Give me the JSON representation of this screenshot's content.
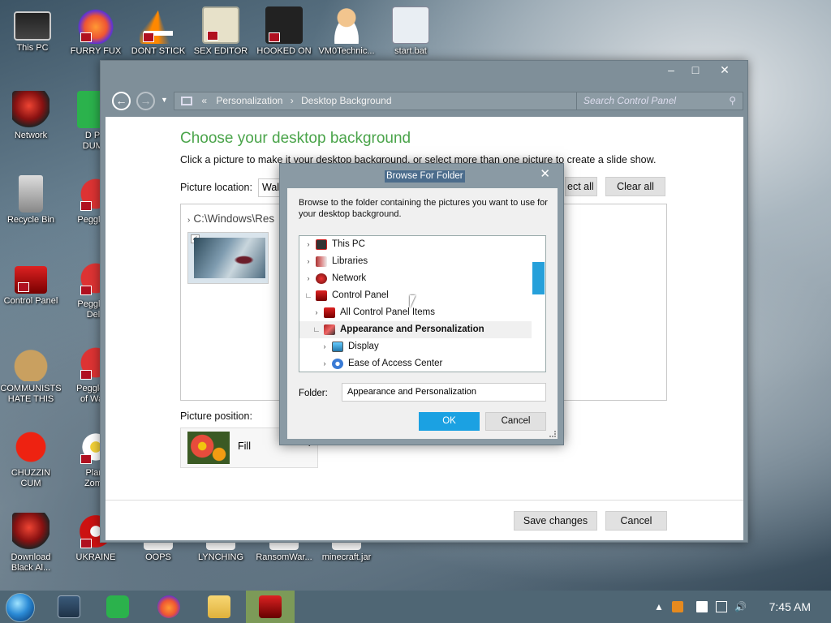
{
  "desktop": {
    "icons": [
      {
        "label": "This PC",
        "icon": "monitor-icon"
      },
      {
        "label": "FURRY FUX",
        "icon": "firefox-icon"
      },
      {
        "label": "DONT STICK",
        "icon": "vlc-cone-icon"
      },
      {
        "label": "SEX EDITOR",
        "icon": "hxd-icon"
      },
      {
        "label": "HOOKED ON",
        "icon": "hooked-icon"
      },
      {
        "label": "VM0Technic...",
        "icon": "doctor-icon"
      },
      {
        "label": "start.bat",
        "icon": "gear-icon"
      },
      {
        "label": "Network",
        "icon": "network-icon"
      },
      {
        "label": "D PC DUMB",
        "icon": "green-app-icon"
      },
      {
        "label": "Recycle Bin",
        "icon": "recycle-bin-icon"
      },
      {
        "label": "Peggle D",
        "icon": "peggle-icon"
      },
      {
        "label": "Control Panel",
        "icon": "control-panel-icon"
      },
      {
        "label": "Peggle N Delu",
        "icon": "peggle-icon"
      },
      {
        "label": "COMMUNISTS HATE THIS G...",
        "icon": "money-bag-icon"
      },
      {
        "label": "Peggle W of Ward",
        "icon": "peggle-icon"
      },
      {
        "label": "CHUZZIN CUM",
        "icon": "chuzzle-icon"
      },
      {
        "label": "Plant Zomb",
        "icon": "flower-icon"
      },
      {
        "label": "Download Black Al...",
        "icon": "download-icon"
      },
      {
        "label": "UKRAINE",
        "icon": "nuke-icon"
      },
      {
        "label": "OOPS",
        "icon": "file-icon"
      },
      {
        "label": "LYNCHING",
        "icon": "file-icon"
      },
      {
        "label": "RansomWar...",
        "icon": "file-icon"
      },
      {
        "label": "minecraft.jar",
        "icon": "file-icon"
      }
    ]
  },
  "main_window": {
    "breadcrumb": [
      "Personalization",
      "Desktop Background"
    ],
    "search_placeholder": "Search Control Panel",
    "heading": "Choose your desktop background",
    "subheading": "Click a picture to make it your desktop background, or select more than one picture to create a slide show.",
    "picture_location_label": "Picture location:",
    "picture_location_value": "Wall",
    "select_all_label": "ect all",
    "clear_all_label": "Clear all",
    "picture_path": "C:\\Windows\\Res",
    "picture_position_label": "Picture position:",
    "picture_position_value": "Fill",
    "save_changes_label": "Save changes",
    "cancel_label": "Cancel"
  },
  "dialog": {
    "title": "Browse For Folder",
    "description": "Browse to the folder containing the pictures you want to use for your desktop background.",
    "tree": [
      {
        "label": "This PC",
        "icon": "monitor-icon",
        "expanded": false,
        "indent": 0
      },
      {
        "label": "Libraries",
        "icon": "libraries-icon",
        "expanded": false,
        "indent": 0
      },
      {
        "label": "Network",
        "icon": "network-icon",
        "expanded": false,
        "indent": 0
      },
      {
        "label": "Control Panel",
        "icon": "control-panel-icon",
        "expanded": true,
        "indent": 0
      },
      {
        "label": "All Control Panel Items",
        "icon": "control-panel-icon",
        "expanded": false,
        "indent": 1
      },
      {
        "label": "Appearance and Personalization",
        "icon": "personalization-icon",
        "expanded": true,
        "indent": 1,
        "selected": true
      },
      {
        "label": "Display",
        "icon": "display-icon",
        "expanded": false,
        "indent": 2
      },
      {
        "label": "Ease of Access Center",
        "icon": "ease-of-access-icon",
        "expanded": false,
        "indent": 2
      }
    ],
    "folder_label": "Folder:",
    "folder_value": "Appearance and Personalization",
    "ok_label": "OK",
    "cancel_label": "Cancel"
  },
  "taskbar": {
    "apps": [
      "task-view-icon",
      "green-app-icon",
      "firefox-icon",
      "file-explorer-icon",
      "control-panel-icon"
    ],
    "active_app": "control-panel-icon",
    "clock": "7:45 AM"
  }
}
